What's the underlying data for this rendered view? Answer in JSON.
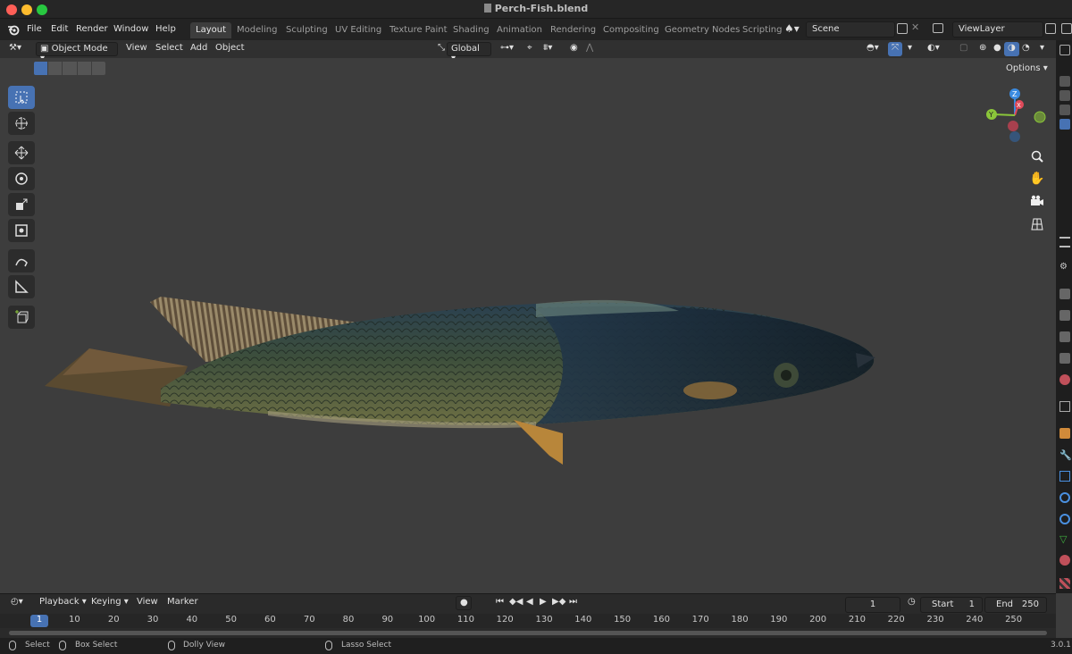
{
  "window": {
    "title": "Perch-Fish.blend"
  },
  "menu": [
    "File",
    "Edit",
    "Render",
    "Window",
    "Help"
  ],
  "workspaces": [
    {
      "label": "Layout",
      "active": true
    },
    {
      "label": "Modeling"
    },
    {
      "label": "Sculpting"
    },
    {
      "label": "UV Editing"
    },
    {
      "label": "Texture Paint"
    },
    {
      "label": "Shading"
    },
    {
      "label": "Animation"
    },
    {
      "label": "Rendering"
    },
    {
      "label": "Compositing"
    },
    {
      "label": "Geometry Nodes"
    },
    {
      "label": "Scripting"
    }
  ],
  "scene": {
    "value": "Scene"
  },
  "viewlayer": {
    "value": "ViewLayer"
  },
  "viewport_header": {
    "mode": "Object Mode",
    "menus": [
      "View",
      "Select",
      "Add",
      "Object"
    ],
    "orientation": "Global",
    "options_label": "Options"
  },
  "gizmo": {
    "x": "X",
    "y": "Y",
    "z": "Z"
  },
  "timeline": {
    "menus": [
      "Playback",
      "Keying",
      "View",
      "Marker"
    ],
    "current_frame": "1",
    "start_label": "Start",
    "start": "1",
    "end_label": "End",
    "end": "250",
    "ticks": [
      "1",
      "10",
      "20",
      "30",
      "40",
      "50",
      "60",
      "70",
      "80",
      "90",
      "100",
      "110",
      "120",
      "130",
      "140",
      "150",
      "160",
      "170",
      "180",
      "190",
      "200",
      "210",
      "220",
      "230",
      "240",
      "250"
    ]
  },
  "status": {
    "select": "Select",
    "box_select": "Box Select",
    "dolly_view": "Dolly View",
    "lasso_select": "Lasso Select",
    "version": "3.0.1"
  },
  "colors": {
    "accent": "#4772b3",
    "axis_x": "#e04a5a",
    "axis_y": "#8bc63a",
    "axis_z": "#3b8be0"
  }
}
